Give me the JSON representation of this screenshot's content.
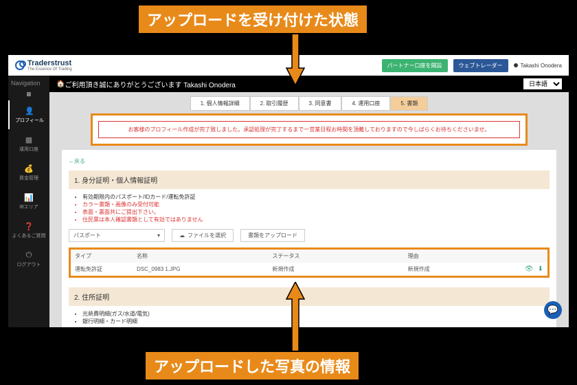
{
  "callouts": {
    "top": "アップロードを受け付けた状態",
    "bottom": "アップロードした写真の情報"
  },
  "brand": {
    "name": "Traderstrust",
    "tagline": "The Essence Of Trading"
  },
  "topbar": {
    "partner_btn": "パートナー口座を開設",
    "web_btn": "ウェブトレーダー",
    "user_name": "Takashi Onodera"
  },
  "sidenav": {
    "label": "Navigation",
    "items": [
      {
        "icon": "👤",
        "label": "プロフィール"
      },
      {
        "icon": "▦",
        "label": "運用口座"
      },
      {
        "icon": "💰",
        "label": "資金管理"
      },
      {
        "icon": "📊",
        "label": "IBエリア"
      },
      {
        "icon": "❓",
        "label": "よくあるご質問"
      },
      {
        "icon": "⏻",
        "label": "ログアウト"
      }
    ]
  },
  "welcome": {
    "greeting": "ご利用頂き誠にありがとうございます Takashi Onodera",
    "lang": "日本語"
  },
  "tabs": [
    {
      "label": "1. 個人情報詳細"
    },
    {
      "label": "2. 取引履歴"
    },
    {
      "label": "3. 同意書"
    },
    {
      "label": "4. 運用口座"
    },
    {
      "label": "5. 書類",
      "active": true
    }
  ],
  "alert": "お客様のプロフィール作成が完了致しました。承認処理が完了するまで一営業日程お時間を頂戴しておりますので今しばらくお待ちくださいませ。",
  "back": "←戻る",
  "section1": {
    "title": "1. 身分証明・個人情報証明",
    "bullets": [
      {
        "text": "有効期限内のパスポート/IDカード/運転免許証",
        "red": false
      },
      {
        "text": "カラー書類・画像のみ受付可能",
        "red": true
      },
      {
        "text": "表面・裏面共にご提出下さい。",
        "red": true
      },
      {
        "text": "住民票は本人確認書類として有効ではありません",
        "red": true
      }
    ],
    "doc_select": "パスポート",
    "file_btn": "ファイルを選択",
    "upload_btn": "書類をアップロード",
    "table": {
      "headers": [
        "タイプ",
        "名称",
        "ステータス",
        "理由"
      ],
      "row": [
        "運転免許証",
        "DSC_0983 1.JPG",
        "新規作成",
        "新規作成"
      ]
    }
  },
  "section2": {
    "title": "2. 住所証明",
    "bullets": [
      {
        "text": "光熱費明細(ガス/水道/電気)"
      },
      {
        "text": "銀行明細・カード明細"
      }
    ]
  }
}
